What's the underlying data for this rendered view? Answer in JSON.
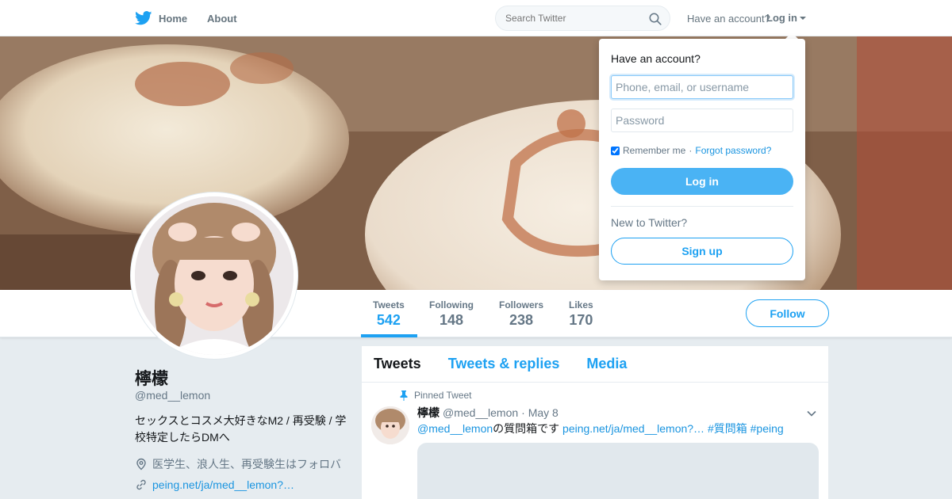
{
  "nav": {
    "home_label": "Home",
    "about_label": "About",
    "search_placeholder": "Search Twitter",
    "have_account": "Have an account?",
    "login_label": "Log in"
  },
  "profile": {
    "name": "檸檬",
    "handle": "@med__lemon",
    "bio": "セックスとコスメ大好きなM2 / 再受験 / 学校特定したらDMへ",
    "location": "医学生、浪人生、再受験生はフォロバ",
    "link": "peing.net/ja/med__lemon?…",
    "follow_label": "Follow"
  },
  "stats": [
    {
      "label": "Tweets",
      "value": "542",
      "active": true
    },
    {
      "label": "Following",
      "value": "148",
      "active": false
    },
    {
      "label": "Followers",
      "value": "238",
      "active": false
    },
    {
      "label": "Likes",
      "value": "170",
      "active": false
    }
  ],
  "timeline": {
    "tabs": [
      "Tweets",
      "Tweets & replies",
      "Media"
    ],
    "pinned_label": "Pinned Tweet",
    "tweet": {
      "name": "檸檬",
      "handle": "@med__lemon",
      "date": "· May 8",
      "mention": "@med__lemon",
      "text": "の質問箱です",
      "link": "peing.net/ja/med__lemon?…",
      "hashtag1": "#質問箱",
      "hashtag2": "#peing"
    }
  },
  "login_dropdown": {
    "title": "Have an account?",
    "username_placeholder": "Phone, email, or username",
    "password_placeholder": "Password",
    "remember_label": "Remember me",
    "separator": "·",
    "forgot_label": "Forgot password?",
    "login_button": "Log in",
    "new_label": "New to Twitter?",
    "signup_button": "Sign up"
  },
  "colors": {
    "accent": "#1da1f2",
    "login_button": "#4ab3f4",
    "background": "#e6ecf0"
  }
}
